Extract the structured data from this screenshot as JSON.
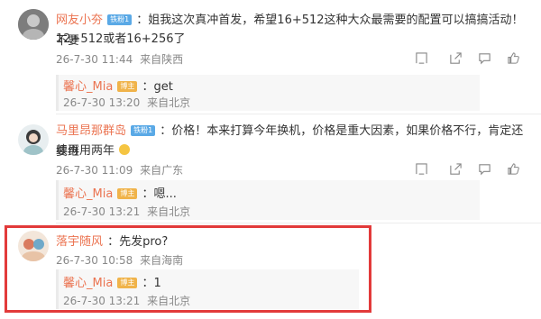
{
  "comments": [
    {
      "user": "网友小夯",
      "badge": "铁粉1",
      "text_line1": "：姐我这次真冲首发，希望16+512这种大众最需要的配置可以搞搞活动！不要",
      "text_line2": "12+512或者16+256了",
      "date": "26-7-30 11:44",
      "location": "来自陕西",
      "reply": {
        "user": "馨心_Mia",
        "badge": "博主",
        "text": "：get",
        "date": "26-7-30 13:20",
        "location": "来自北京"
      }
    },
    {
      "user": "马里昂那群岛",
      "badge": "铁粉1",
      "text_line1": "：价格！本来打算今年换机，价格是重大因素，如果价格不行，肯定还要继",
      "text_line2": "续再用两年",
      "date": "26-7-30 11:09",
      "location": "来自广东",
      "reply": {
        "user": "馨心_Mia",
        "badge": "博主",
        "text": "：嗯...",
        "date": "26-7-30 13:21",
        "location": "来自北京"
      }
    },
    {
      "user": "落宇随风",
      "text_line1": "：先发pro?",
      "date": "26-7-30 10:58",
      "location": "来自海南",
      "reply": {
        "user": "馨心_Mia",
        "badge": "博主",
        "text": "：1",
        "date": "26-7-30 13:21",
        "location": "来自北京"
      }
    }
  ],
  "icons": [
    "report-icon",
    "share-icon",
    "comment-icon",
    "like-icon"
  ],
  "colors": {
    "username": "#eb7350",
    "highlight": "#e23a3a"
  }
}
